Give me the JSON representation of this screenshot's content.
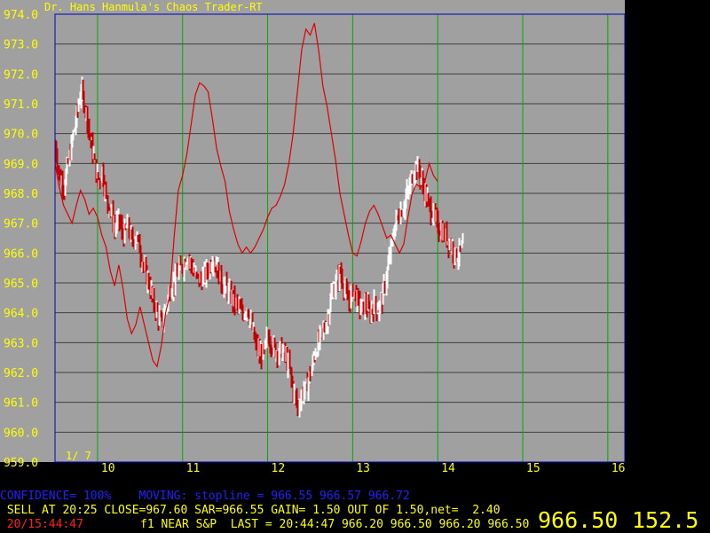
{
  "app_title": "Dr. Hans Hanmula's Chaos Trader-RT",
  "page_indicator": "1/ 7",
  "colors": {
    "background": "#a0a0a0",
    "grid_horizontal": "#404040",
    "grid_vertical": "#00aa00",
    "frame": "#0000c0",
    "axis_text": "#ffff00",
    "bar_up": "#ffffff",
    "bar_down": "#c00000",
    "oscillator": "#dd0000",
    "status_blue": "#2020ff",
    "status_yellow": "#ffff00",
    "status_red": "#ff2020"
  },
  "chart_data": {
    "type": "candlestick",
    "title": "Dr. Hans Hanmula's Chaos Trader-RT",
    "ylim": [
      959.0,
      974.0
    ],
    "y_ticks": [
      "974.0",
      "973.0",
      "972.0",
      "971.0",
      "970.0",
      "969.0",
      "968.0",
      "967.0",
      "966.0",
      "965.0",
      "964.0",
      "963.0",
      "962.0",
      "961.0",
      "960.0",
      "959.0"
    ],
    "x_ticks": [
      "10",
      "11",
      "12",
      "13",
      "14",
      "15",
      "16"
    ],
    "xlim": [
      9.5,
      16.2
    ],
    "grid": true,
    "price_path": [
      [
        9.5,
        969.6
      ],
      [
        9.55,
        968.5
      ],
      [
        9.6,
        968.3
      ],
      [
        9.65,
        969.0
      ],
      [
        9.7,
        969.8
      ],
      [
        9.75,
        970.6
      ],
      [
        9.8,
        971.5
      ],
      [
        9.85,
        970.9
      ],
      [
        9.9,
        970.0
      ],
      [
        9.95,
        969.2
      ],
      [
        10.0,
        968.3
      ],
      [
        10.05,
        968.8
      ],
      [
        10.1,
        967.8
      ],
      [
        10.15,
        967.4
      ],
      [
        10.2,
        966.8
      ],
      [
        10.25,
        967.1
      ],
      [
        10.3,
        966.6
      ],
      [
        10.35,
        966.9
      ],
      [
        10.4,
        966.4
      ],
      [
        10.45,
        966.6
      ],
      [
        10.5,
        966.0
      ],
      [
        10.55,
        965.4
      ],
      [
        10.6,
        965.0
      ],
      [
        10.65,
        964.4
      ],
      [
        10.7,
        964.0
      ],
      [
        10.75,
        963.6
      ],
      [
        10.8,
        964.2
      ],
      [
        10.85,
        964.8
      ],
      [
        10.9,
        965.0
      ],
      [
        10.95,
        965.4
      ],
      [
        11.0,
        965.6
      ],
      [
        11.05,
        965.9
      ],
      [
        11.1,
        965.6
      ],
      [
        11.15,
        965.2
      ],
      [
        11.2,
        965.1
      ],
      [
        11.25,
        965.2
      ],
      [
        11.3,
        965.5
      ],
      [
        11.35,
        965.8
      ],
      [
        11.4,
        965.6
      ],
      [
        11.45,
        965.0
      ],
      [
        11.5,
        964.9
      ],
      [
        11.55,
        964.6
      ],
      [
        11.6,
        964.4
      ],
      [
        11.65,
        964.2
      ],
      [
        11.7,
        963.9
      ],
      [
        11.75,
        964.2
      ],
      [
        11.8,
        963.6
      ],
      [
        11.85,
        963.0
      ],
      [
        11.9,
        962.6
      ],
      [
        11.95,
        962.7
      ],
      [
        12.0,
        963.2
      ],
      [
        12.05,
        962.9
      ],
      [
        12.1,
        962.7
      ],
      [
        12.15,
        962.8
      ],
      [
        12.2,
        962.6
      ],
      [
        12.25,
        962.1
      ],
      [
        12.3,
        961.4
      ],
      [
        12.35,
        960.8
      ],
      [
        12.4,
        961.3
      ],
      [
        12.45,
        961.5
      ],
      [
        12.5,
        962.0
      ],
      [
        12.55,
        962.6
      ],
      [
        12.6,
        963.1
      ],
      [
        12.65,
        963.4
      ],
      [
        12.7,
        963.8
      ],
      [
        12.75,
        964.6
      ],
      [
        12.8,
        965.0
      ],
      [
        12.85,
        965.4
      ],
      [
        12.9,
        964.8
      ],
      [
        12.95,
        964.3
      ],
      [
        13.0,
        964.8
      ],
      [
        13.05,
        964.4
      ],
      [
        13.1,
        964.1
      ],
      [
        13.15,
        964.3
      ],
      [
        13.2,
        964.0
      ],
      [
        13.25,
        964.3
      ],
      [
        13.3,
        964.1
      ],
      [
        13.35,
        964.6
      ],
      [
        13.4,
        965.4
      ],
      [
        13.45,
        966.2
      ],
      [
        13.5,
        967.0
      ],
      [
        13.55,
        967.3
      ],
      [
        13.6,
        967.6
      ],
      [
        13.65,
        968.1
      ],
      [
        13.7,
        968.6
      ],
      [
        13.75,
        968.9
      ],
      [
        13.8,
        968.5
      ],
      [
        13.85,
        968.0
      ],
      [
        13.9,
        967.5
      ],
      [
        13.95,
        967.2
      ],
      [
        14.0,
        966.9
      ],
      [
        14.05,
        966.7
      ],
      [
        14.1,
        966.5
      ],
      [
        14.15,
        966.3
      ],
      [
        14.2,
        965.9
      ],
      [
        14.25,
        966.0
      ],
      [
        14.3,
        966.4
      ]
    ],
    "oscillator_path": [
      [
        9.5,
        969.0
      ],
      [
        9.55,
        968.2
      ],
      [
        9.6,
        967.6
      ],
      [
        9.65,
        967.3
      ],
      [
        9.7,
        967.0
      ],
      [
        9.75,
        967.6
      ],
      [
        9.8,
        968.1
      ],
      [
        9.85,
        967.8
      ],
      [
        9.9,
        967.3
      ],
      [
        9.95,
        967.5
      ],
      [
        10.0,
        967.2
      ],
      [
        10.05,
        966.6
      ],
      [
        10.1,
        966.2
      ],
      [
        10.15,
        965.4
      ],
      [
        10.2,
        964.9
      ],
      [
        10.25,
        965.6
      ],
      [
        10.3,
        964.8
      ],
      [
        10.35,
        963.8
      ],
      [
        10.4,
        963.3
      ],
      [
        10.45,
        963.6
      ],
      [
        10.5,
        964.2
      ],
      [
        10.55,
        963.6
      ],
      [
        10.6,
        963.0
      ],
      [
        10.65,
        962.4
      ],
      [
        10.7,
        962.2
      ],
      [
        10.75,
        962.9
      ],
      [
        10.8,
        964.0
      ],
      [
        10.85,
        964.6
      ],
      [
        10.9,
        966.5
      ],
      [
        10.95,
        968.1
      ],
      [
        11.0,
        968.6
      ],
      [
        11.05,
        969.3
      ],
      [
        11.1,
        970.3
      ],
      [
        11.15,
        971.3
      ],
      [
        11.2,
        971.7
      ],
      [
        11.25,
        971.6
      ],
      [
        11.3,
        971.4
      ],
      [
        11.35,
        970.5
      ],
      [
        11.4,
        969.5
      ],
      [
        11.45,
        968.9
      ],
      [
        11.5,
        968.4
      ],
      [
        11.55,
        967.4
      ],
      [
        11.6,
        966.8
      ],
      [
        11.65,
        966.3
      ],
      [
        11.7,
        966.0
      ],
      [
        11.75,
        966.2
      ],
      [
        11.8,
        966.0
      ],
      [
        11.85,
        966.2
      ],
      [
        11.9,
        966.5
      ],
      [
        11.95,
        966.8
      ],
      [
        12.0,
        967.2
      ],
      [
        12.05,
        967.5
      ],
      [
        12.1,
        967.6
      ],
      [
        12.15,
        967.9
      ],
      [
        12.2,
        968.3
      ],
      [
        12.25,
        969.0
      ],
      [
        12.3,
        970.0
      ],
      [
        12.35,
        971.4
      ],
      [
        12.4,
        972.8
      ],
      [
        12.45,
        973.5
      ],
      [
        12.5,
        973.3
      ],
      [
        12.55,
        973.7
      ],
      [
        12.6,
        972.8
      ],
      [
        12.65,
        971.6
      ],
      [
        12.7,
        970.9
      ],
      [
        12.75,
        970.0
      ],
      [
        12.8,
        969.1
      ],
      [
        12.85,
        968.0
      ],
      [
        12.9,
        967.3
      ],
      [
        12.95,
        966.6
      ],
      [
        13.0,
        966.0
      ],
      [
        13.05,
        965.9
      ],
      [
        13.1,
        966.4
      ],
      [
        13.15,
        967.0
      ],
      [
        13.2,
        967.4
      ],
      [
        13.25,
        967.6
      ],
      [
        13.3,
        967.3
      ],
      [
        13.35,
        966.9
      ],
      [
        13.4,
        966.5
      ],
      [
        13.45,
        966.6
      ],
      [
        13.5,
        966.3
      ],
      [
        13.55,
        966.0
      ],
      [
        13.6,
        966.3
      ],
      [
        13.65,
        967.2
      ],
      [
        13.7,
        968.0
      ],
      [
        13.75,
        968.3
      ],
      [
        13.8,
        968.2
      ],
      [
        13.85,
        968.4
      ],
      [
        13.9,
        969.0
      ],
      [
        13.95,
        968.6
      ],
      [
        14.0,
        968.4
      ]
    ],
    "last_quote": "966.50"
  },
  "status": {
    "line1": "CONFIDENCE= 100%    MOVING: stopline = 966.55 966.57 966.72",
    "line2": " SELL AT 20:25 CLOSE=967.60 SAR=966.55 GAIN= 1.50 OUT OF 1.50,net=  2.40",
    "time": " 20/15:44:47",
    "line3": "f1 NEAR S&P  LAST = 20:44:47 966.20 966.50 966.20 966.50",
    "big_price": "966.50",
    "big_change": "152.5"
  }
}
